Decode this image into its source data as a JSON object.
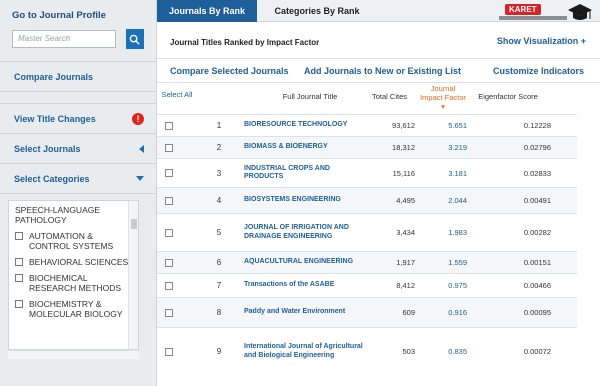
{
  "sidebar": {
    "title": "Go to Journal Profile",
    "search_placeholder": "Master Search",
    "items": [
      {
        "label": "Compare Journals"
      },
      {
        "label": "View Title Changes"
      },
      {
        "label": "Select Journals"
      },
      {
        "label": "Select Categories"
      }
    ],
    "warning_glyph": "!",
    "categories": [
      {
        "label": "SPEECH-LANGUAGE PATHOLOGY",
        "checkbox": false
      },
      {
        "label": "AUTOMATION & CONTROL SYSTEMS",
        "checkbox": true
      },
      {
        "label": "BEHAVIORAL SCIENCES",
        "checkbox": true
      },
      {
        "label": "BIOCHEMICAL RESEARCH METHODS",
        "checkbox": true
      },
      {
        "label": "BIOCHEMISTRY & MOLECULAR BIOLOGY",
        "checkbox": true
      }
    ]
  },
  "tabs": {
    "active": "Journals By Rank",
    "inactive": "Categories By Rank"
  },
  "brand": {
    "name": "KARET"
  },
  "header": {
    "title": "Journal Titles Ranked by Impact Factor",
    "show_viz": "Show Visualization +"
  },
  "actions": {
    "compare": "Compare Selected Journals",
    "add": "Add Journals to New or Existing List",
    "customize": "Customize Indicators"
  },
  "table": {
    "headers": {
      "select": "Select All",
      "title": "Full Journal Title",
      "cites": "Total Cites",
      "jif": "Journal Impact Factor ▾",
      "eig": "Eigenfactor Score"
    },
    "rows": [
      {
        "rank": "1",
        "title": "BIORESOURCE TECHNOLOGY",
        "cites": "93,612",
        "jif": "5.651",
        "eig": "0.12228"
      },
      {
        "rank": "2",
        "title": "BIOMASS & BIOENERGY",
        "cites": "18,312",
        "jif": "3.219",
        "eig": "0.02796"
      },
      {
        "rank": "3",
        "title": "INDUSTRIAL CROPS AND PRODUCTS",
        "cites": "15,116",
        "jif": "3.181",
        "eig": "0.02833"
      },
      {
        "rank": "4",
        "title": "BIOSYSTEMS ENGINEERING",
        "cites": "4,495",
        "jif": "2.044",
        "eig": "0.00491"
      },
      {
        "rank": "5",
        "title": "JOURNAL OF IRRIGATION AND DRAINAGE ENGINEERING",
        "cites": "3,434",
        "jif": "1.983",
        "eig": "0.00282"
      },
      {
        "rank": "6",
        "title": "AQUACULTURAL ENGINEERING",
        "cites": "1,917",
        "jif": "1.559",
        "eig": "0.00151"
      },
      {
        "rank": "7",
        "title": "Transactions of the ASABE",
        "cites": "8,412",
        "jif": "0.975",
        "eig": "0.00466"
      },
      {
        "rank": "8",
        "title": "Paddy and Water Environment",
        "cites": "609",
        "jif": "0.916",
        "eig": "0.00095"
      },
      {
        "rank": "9",
        "title": "International Journal of Agricultural and Biological Engineering",
        "cites": "503",
        "jif": "0.835",
        "eig": "0.00072"
      }
    ]
  }
}
